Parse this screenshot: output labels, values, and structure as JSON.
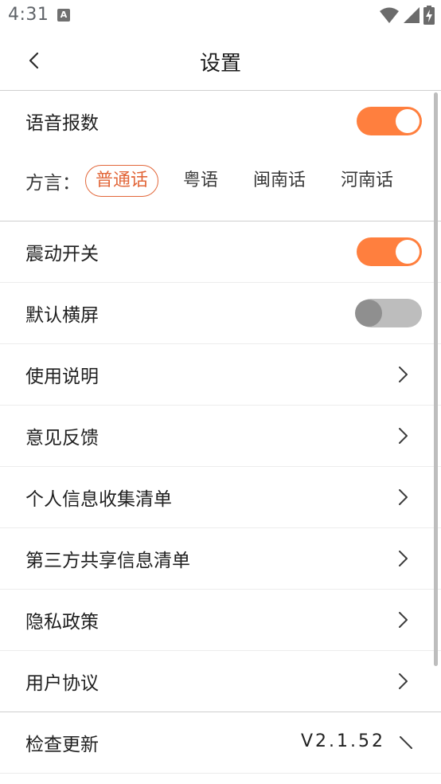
{
  "status_bar": {
    "time": "4:31",
    "app_icon_letter": "A"
  },
  "header": {
    "title": "设置"
  },
  "voice": {
    "label": "语音报数",
    "enabled": true,
    "dialect_label": "方言：",
    "dialects": [
      "普通话",
      "粤语",
      "闽南话",
      "河南话"
    ],
    "selected_dialect": "普通话"
  },
  "settings": {
    "vibration": {
      "label": "震动开关",
      "enabled": true
    },
    "landscape": {
      "label": "默认横屏",
      "enabled": false
    },
    "manual": {
      "label": "使用说明"
    },
    "feedback": {
      "label": "意见反馈"
    },
    "personal_info": {
      "label": "个人信息收集清单"
    },
    "third_party": {
      "label": "第三方共享信息清单"
    },
    "privacy": {
      "label": "隐私政策"
    },
    "agreement": {
      "label": "用户协议"
    },
    "update": {
      "label": "检查更新",
      "version": "V2.1.52"
    }
  },
  "colors": {
    "accent": "#ff7f3e",
    "dialect_selected": "#e2673a",
    "toggle_off": "#bdbdbd"
  }
}
